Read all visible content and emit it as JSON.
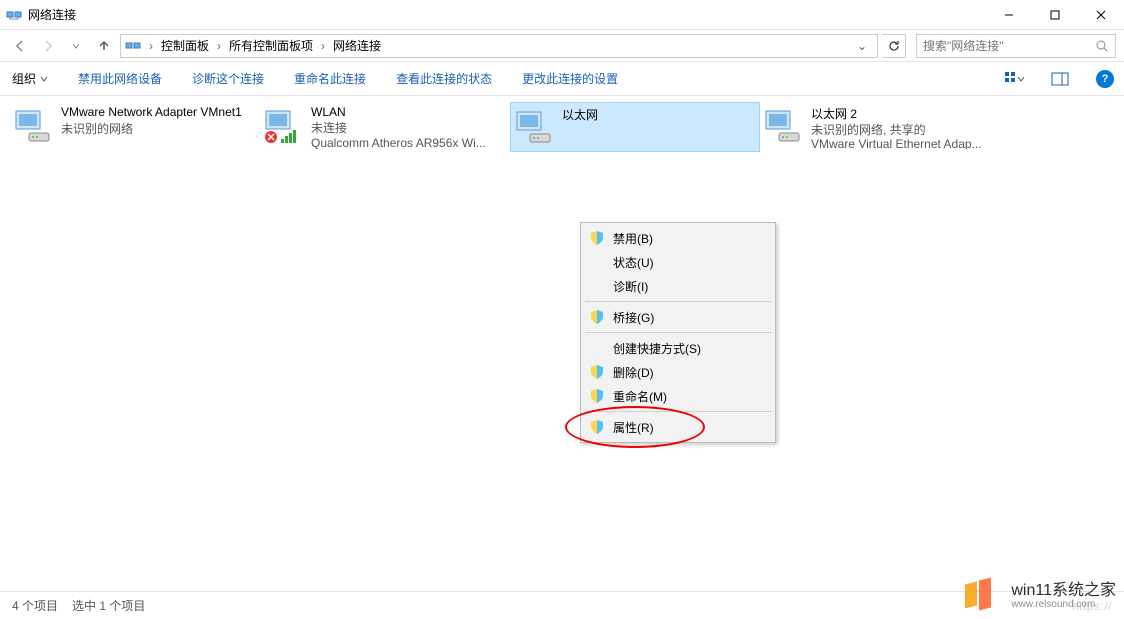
{
  "window": {
    "title": "网络连接"
  },
  "breadcrumb": {
    "items": [
      "控制面板",
      "所有控制面板项",
      "网络连接"
    ]
  },
  "search": {
    "placeholder": "搜索\"网络连接\""
  },
  "toolbar": {
    "organize": "组织",
    "disable": "禁用此网络设备",
    "diagnose": "诊断这个连接",
    "rename": "重命名此连接",
    "status": "查看此连接的状态",
    "settings": "更改此连接的设置"
  },
  "adapters": [
    {
      "name": "VMware Network Adapter VMnet1",
      "line2": "未识别的网络",
      "line3": "",
      "badge": ""
    },
    {
      "name": "WLAN",
      "line2": "未连接",
      "line3": "Qualcomm Atheros AR956x Wi...",
      "badge": "x"
    },
    {
      "name": "以太网",
      "line2": "",
      "line3": "",
      "badge": ""
    },
    {
      "name": "以太网 2",
      "line2": "未识别的网络, 共享的",
      "line3": "VMware Virtual Ethernet Adap...",
      "badge": ""
    }
  ],
  "context_menu": [
    {
      "label": "禁用(B)",
      "shield": true
    },
    {
      "label": "状态(U)",
      "shield": false
    },
    {
      "label": "诊断(I)",
      "shield": false
    },
    {
      "sep": true
    },
    {
      "label": "桥接(G)",
      "shield": true
    },
    {
      "sep": true
    },
    {
      "label": "创建快捷方式(S)",
      "shield": false
    },
    {
      "label": "删除(D)",
      "shield": true
    },
    {
      "label": "重命名(M)",
      "shield": true
    },
    {
      "sep": true
    },
    {
      "label": "属性(R)",
      "shield": true
    }
  ],
  "status": {
    "count": "4 个项目",
    "selected": "选中 1 个项目",
    "url": "https://"
  },
  "watermark": {
    "line1": "win11系统之家",
    "line2": "www.relsound.com"
  }
}
